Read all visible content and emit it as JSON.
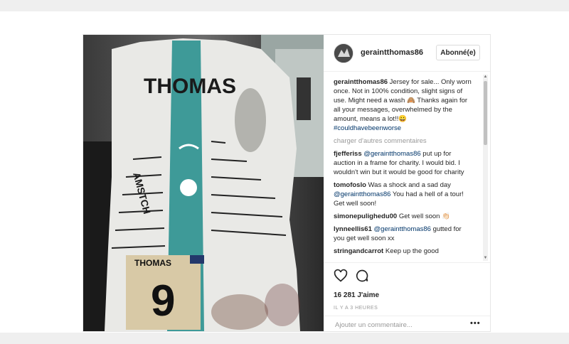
{
  "post": {
    "username": "geraintthomas86",
    "follow_label": "Abonné(e)"
  },
  "caption": {
    "user": "geraintthomas86",
    "text": " Jersey for sale... Only worn once. Not in 100% condition, slight signs of use. Might need a wash 🙈 Thanks again for all your messages, overwhelmed by the amount, means a lot!!😀 ",
    "hashtag": "#couldhavebeenworse"
  },
  "load_more_label": "charger d'autres commentaires",
  "comments": [
    {
      "user": "fjefferiss",
      "mention": "@geraintthomas86",
      "text": " put up for auction in a frame for charity. I would bid. I wouldn't win but it would be good for charity"
    },
    {
      "user": "tomofoslo",
      "text": " Was a shock and a sad day ",
      "mention": "@geraintthomas86",
      "text2": " You had a hell of a tour! Get well soon!"
    },
    {
      "user": "simonepulighedu00",
      "text": " Get well soon 👏🏻"
    },
    {
      "user": "lynneellis61",
      "mention": "@geraintthomas86",
      "text": " gutted for you get well soon xx"
    },
    {
      "user": "stringandcarrot",
      "text": " Keep up the good"
    }
  ],
  "likes_label": "16 281 J'aime",
  "time_label": "IL Y A 3 HEURES",
  "comment_placeholder": "Ajouter un commentaire...",
  "more_label": "•••",
  "jersey": {
    "name": "THOMAS",
    "number": "9",
    "side_text": "AMSTCH"
  },
  "colors": {
    "jersey_white": "#e9e9e6",
    "team_teal": "#3e9a98",
    "link": "#003569"
  },
  "icons": {
    "like": "heart-icon",
    "comment": "speech-bubble-icon",
    "more": "ellipsis-icon"
  }
}
